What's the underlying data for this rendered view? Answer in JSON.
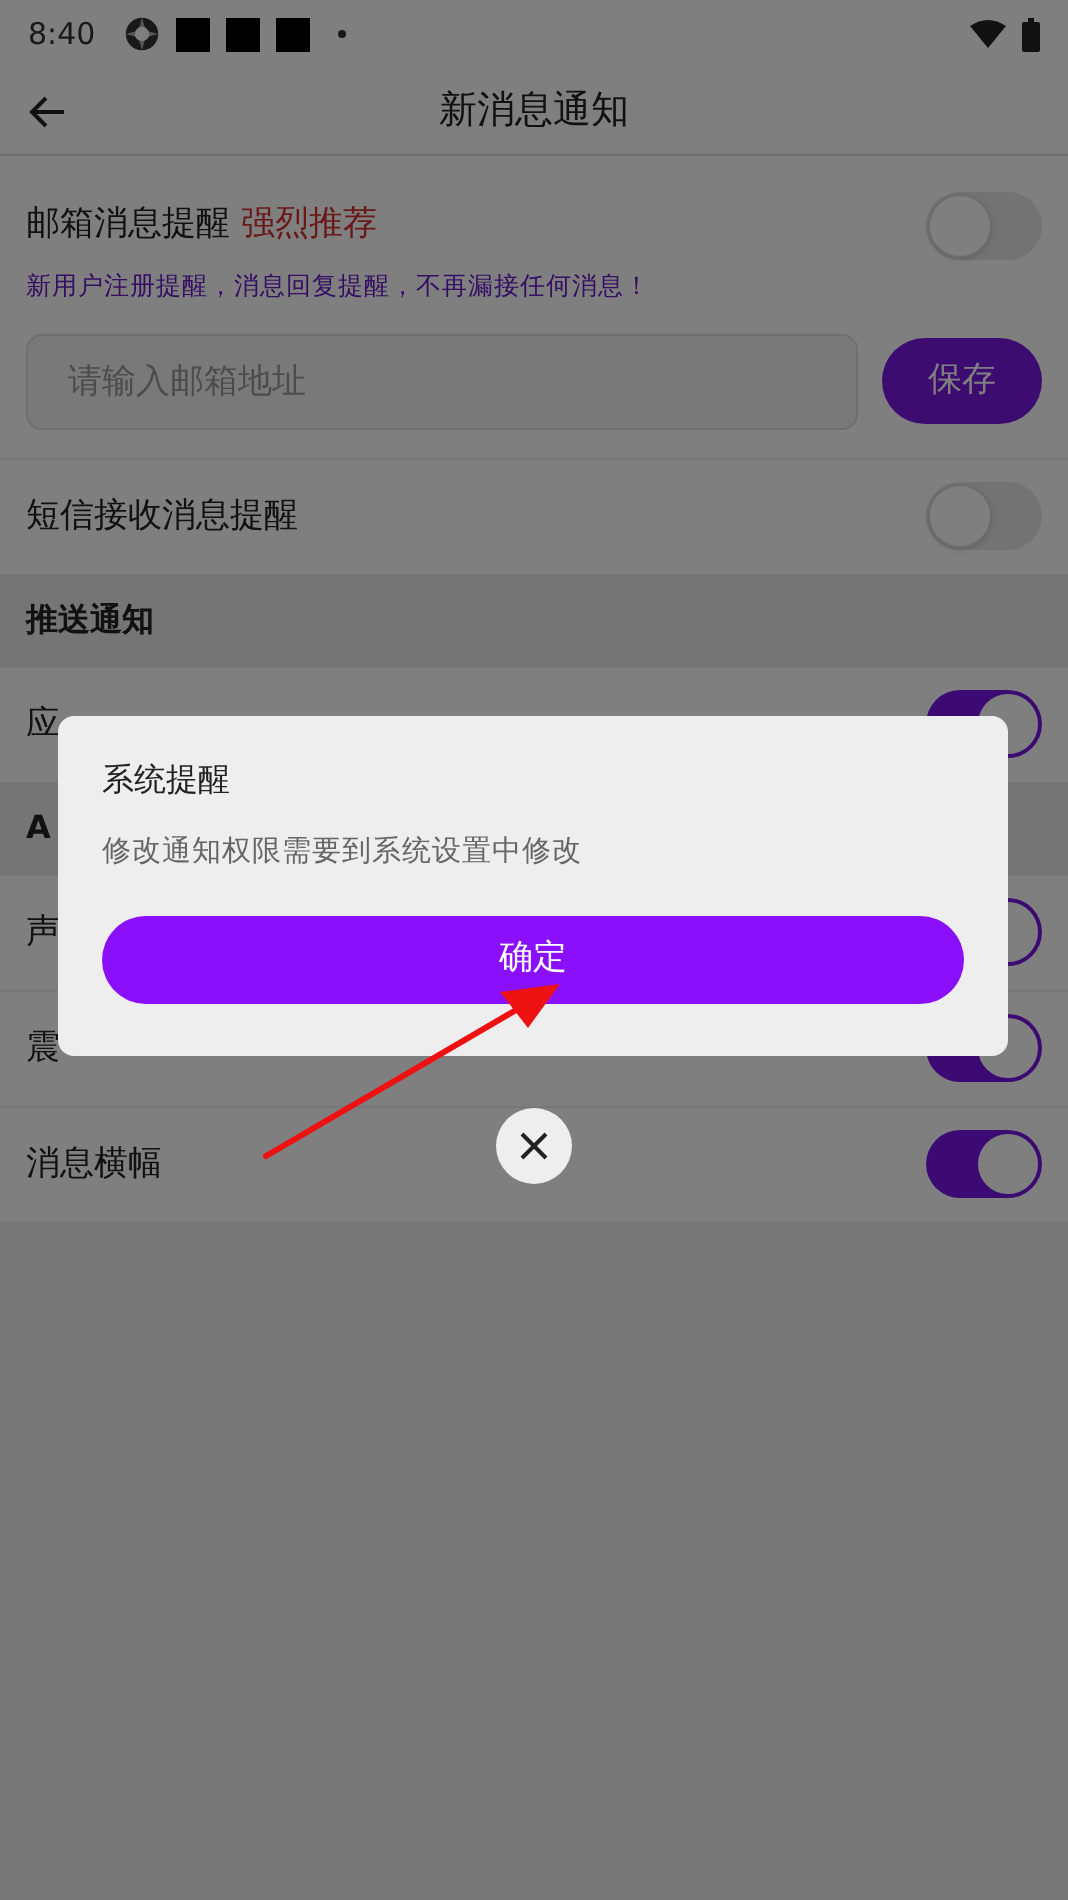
{
  "status_bar": {
    "time": "8:40"
  },
  "header": {
    "title": "新消息通知"
  },
  "email": {
    "label": "邮箱消息提醒",
    "tag": "强烈推荐",
    "hint": "新用户注册提醒，消息回复提醒，不再漏接任何消息！",
    "on": false,
    "input": {
      "placeholder": "请输入邮箱地址"
    },
    "save_button": "保存"
  },
  "sections": [
    {
      "kind": "row",
      "label": "短信接收消息提醒",
      "on": false
    },
    {
      "kind": "header",
      "label": "推送通知"
    },
    {
      "kind": "row",
      "label": "应",
      "on": true
    },
    {
      "kind": "header",
      "label": "A"
    },
    {
      "kind": "row",
      "label": "声",
      "on": true
    },
    {
      "kind": "row",
      "label": "震",
      "on": true
    },
    {
      "kind": "row",
      "label": "消息横幅",
      "on": true
    }
  ],
  "dialog": {
    "title": "系统提醒",
    "message": "修改通知权限需要到系统设置中修改",
    "confirm_button": "确定"
  }
}
